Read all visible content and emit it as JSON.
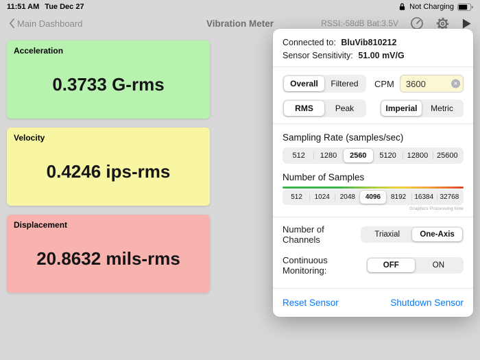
{
  "status_bar": {
    "time": "11:51 AM",
    "date": "Tue Dec 27",
    "battery_status": "Not Charging"
  },
  "nav": {
    "back_label": "Main Dashboard",
    "title": "Vibration Meter",
    "telemetry": "RSSI:-58dB  Bat:3.5V"
  },
  "cards": [
    {
      "title": "Acceleration",
      "value": "0.3733 G-rms",
      "color": "#b7f2ae"
    },
    {
      "title": "Velocity",
      "value": "0.4246 ips-rms",
      "color": "#f8f6a3"
    },
    {
      "title": "Displacement",
      "value": "20.8632 mils-rms",
      "color": "#f8b3ae"
    }
  ],
  "popover": {
    "connected": {
      "label": "Connected to:",
      "value": "BluVib810212"
    },
    "sensitivity": {
      "label": "Sensor Sensitivity:",
      "value": "51.00 mV/G"
    },
    "seg_overall": {
      "options": [
        "Overall",
        "Filtered"
      ],
      "selected": "Overall"
    },
    "cpm": {
      "label": "CPM",
      "value": "3600"
    },
    "seg_rms": {
      "options": [
        "RMS",
        "Peak"
      ],
      "selected": "RMS"
    },
    "seg_units": {
      "options": [
        "Imperial",
        "Metric"
      ],
      "selected": "Imperial"
    },
    "sampling": {
      "label": "Sampling Rate (samples/sec)",
      "options": [
        "512",
        "1280",
        "2560",
        "5120",
        "12800",
        "25600"
      ],
      "selected": "2560"
    },
    "samples": {
      "label": "Number of Samples",
      "options": [
        "512",
        "1024",
        "2048",
        "4096",
        "8192",
        "16384",
        "32768"
      ],
      "selected": "4096",
      "note": "Graphics Processing time"
    },
    "channels": {
      "label": "Number of Channels",
      "options": [
        "Triaxial",
        "One-Axis"
      ],
      "selected": "One-Axis"
    },
    "monitoring": {
      "label": "Continuous Monitoring:",
      "options": [
        "OFF",
        "ON"
      ],
      "selected": "OFF"
    },
    "links": {
      "reset": "Reset Sensor",
      "shutdown": "Shutdown Sensor"
    }
  },
  "icons": {
    "clear": "✕"
  },
  "colors": {
    "accent_blue": "#007aff"
  }
}
